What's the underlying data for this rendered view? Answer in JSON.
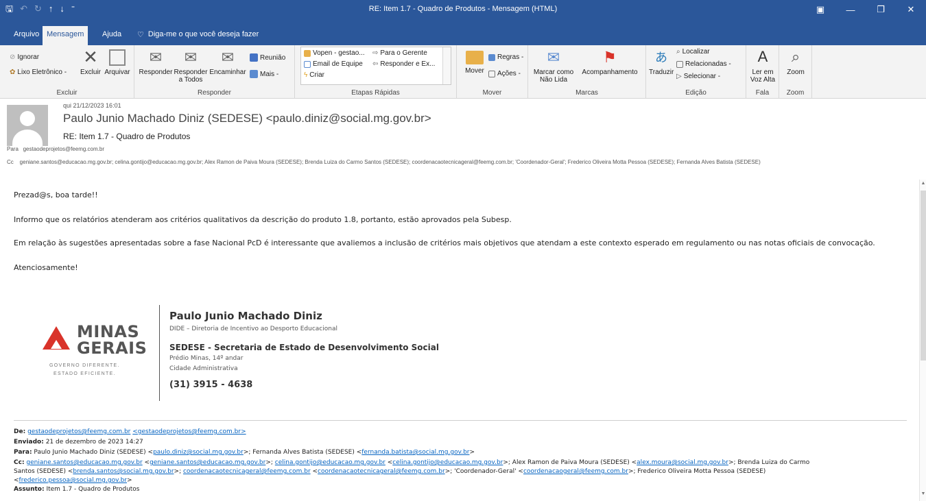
{
  "window": {
    "title": "RE: Item 1.7 - Quadro de Produtos  -  Mensagem (HTML)",
    "controls": [
      "▣",
      "—",
      "❐",
      "✕"
    ]
  },
  "tabs": [
    {
      "label": "Arquivo"
    },
    {
      "label": "Mensagem"
    },
    {
      "label": "Ajuda"
    }
  ],
  "tellme": "Diga-me o que você deseja fazer",
  "ribbon": {
    "excluir": {
      "ignorar": "Ignorar",
      "lixo": "Lixo Eletrônico -",
      "excluir": "Excluir",
      "arquivar": "Arquivar",
      "label": "Excluir"
    },
    "responder": {
      "responder": "Responder",
      "todos": "Responder a Todos",
      "encaminhar": "Encaminhar",
      "reuniao": "Reunião",
      "mais": "Mais -",
      "label": "Responder"
    },
    "etapas": {
      "items": [
        "Vopen - gestao...",
        "Email de Equipe",
        "Criar",
        "Para o Gerente",
        "Responder e Ex..."
      ],
      "label": "Etapas Rápidas"
    },
    "mover": {
      "mover": "Mover",
      "regras": "Regras -",
      "acoes": "Ações -",
      "label": "Mover"
    },
    "marcas": {
      "marcar": "Marcar como Não Lida",
      "acomp": "Acompanhamento",
      "label": "Marcas"
    },
    "edicao": {
      "traduzir": "Traduzir",
      "localizar": "Localizar",
      "relacionadas": "Relacionadas -",
      "selecionar": "Selecionar -",
      "label": "Edição"
    },
    "fala": {
      "ler": "Ler em Voz Alta",
      "label": "Fala"
    },
    "zoom": {
      "zoom": "Zoom",
      "label": "Zoom"
    }
  },
  "header": {
    "date": "qui 21/12/2023 16:01",
    "from": "Paulo Junio Machado Diniz (SEDESE) <paulo.diniz@social.mg.gov.br>",
    "subject": "RE: Item 1.7 - Quadro de Produtos",
    "to_label": "Para",
    "to": "gestaodeprojetos@feemg.com.br",
    "cc_label": "Cc",
    "cc": "geniane.santos@educacao.mg.gov.br; celina.gontijo@educacao.mg.gov.br; Alex Ramon de Paiva Moura (SEDESE); Brenda Luiza do Carmo Santos (SEDESE); coordenacaotecnicageral@feemg.com.br; 'Coordenador-Geral'; Frederico Oliveira Motta Pessoa (SEDESE); Fernanda Alves Batista (SEDESE)"
  },
  "body": {
    "greeting": "Prezad@s, boa tarde!!",
    "p1": "Informo que os relatórios atenderam aos critérios qualitativos da descrição do produto 1.8, portanto, estão aprovados pela Subesp.",
    "p2": "Em relação às sugestões apresentadas sobre a fase Nacional PcD é interessante que avaliemos a inclusão de critérios mais objetivos que atendam a este contexto esperado em regulamento ou nas notas oficiais de convocação.",
    "closing": "Atenciosamente!"
  },
  "signature": {
    "logo_word1": "MINAS",
    "logo_word2": "GERAIS",
    "logo_sub1": "GOVERNO DIFERENTE.",
    "logo_sub2": "ESTADO EFICIENTE.",
    "name": "Paulo Junio Machado Diniz",
    "dept": "DIDE – Diretoria de Incentivo ao Desporto Educacional",
    "org": "SEDESE - Secretaria de Estado de Desenvolvimento Social",
    "addr1": "Prédio Minas, 14º andar",
    "addr2": "Cidade Administrativa",
    "phone": "(31) 3915 - 4638"
  },
  "quoted": {
    "de_label": "De:",
    "de_link1": "gestaodeprojetos@feemg.com.br",
    "de_link2": "<gestaodeprojetos@feemg.com.br>",
    "enviado_label": "Enviado:",
    "enviado": "21 de dezembro de 2023 14:27",
    "para_label": "Para:",
    "para_1": "Paulo Junio Machado Diniz (SEDESE) <",
    "para_link1": "paulo.diniz@social.mg.gov.br",
    "para_2": ">; Fernanda Alves Batista (SEDESE) <",
    "para_link2": "fernanda.batista@social.mg.gov.br",
    "para_3": ">",
    "cc_label": "Cc:",
    "cc_line1_a": "geniane.santos@educacao.mg.gov.br",
    "cc_line1_b": " <",
    "cc_line1_c": "geniane.santos@educacao.mg.gov.br",
    "cc_line1_d": ">; ",
    "cc_line1_e": "celina.gontijo@educacao.mg.gov.br",
    "cc_line1_f": " <",
    "cc_line1_g": "celina.gontijo@educacao.mg.gov.br",
    "cc_line1_h": ">; Alex Ramon de Paiva Moura (SEDESE) <",
    "cc_line1_i": "alex.moura@social.mg.gov.br",
    "cc_line1_j": ">; Brenda Luiza do Carmo",
    "cc_line2_a": "Santos (SEDESE) <",
    "cc_line2_b": "brenda.santos@social.mg.gov.br",
    "cc_line2_c": ">; ",
    "cc_line2_d": "coordenacaotecnicageral@feemg.com.br",
    "cc_line2_e": " <",
    "cc_line2_f": "coordenacaotecnicageral@feemg.com.br",
    "cc_line2_g": ">; 'Coordenador-Geral' <",
    "cc_line2_h": "coordenacaogeral@feemg.com.br",
    "cc_line2_i": ">; Frederico Oliveira Motta Pessoa (SEDESE)",
    "cc_line3_a": "<",
    "cc_line3_b": "frederico.pessoa@social.mg.gov.br",
    "cc_line3_c": ">",
    "assunto_label": "Assunto:",
    "assunto": "Item 1.7 - Quadro de Produtos"
  },
  "colors": {
    "brand": "#2b579a",
    "link": "#0563c1",
    "logo_red": "#d9332a"
  }
}
